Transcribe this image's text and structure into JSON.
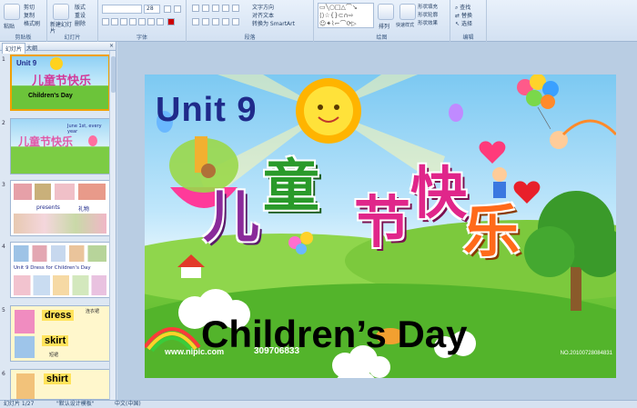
{
  "ribbon": {
    "clipboard": {
      "label": "剪贴板",
      "paste": "粘贴",
      "cut": "剪切",
      "copy": "复制",
      "format_painter": "格式刷"
    },
    "slides": {
      "label": "幻灯片",
      "new_slide": "新建幻灯片",
      "layout": "版式",
      "reset": "重设",
      "delete": "删除"
    },
    "font": {
      "label": "字体",
      "size": "28"
    },
    "paragraph": {
      "label": "段落",
      "text_direction": "文字方向",
      "align_text": "对齐文本",
      "smartart": "转换为 SmartArt"
    },
    "drawing": {
      "label": "绘图",
      "arrange": "排列",
      "quick_styles": "快速样式",
      "shape_fill": "形状填充",
      "shape_outline": "形状轮廓",
      "shape_effects": "形状效果"
    },
    "editing": {
      "label": "编辑",
      "find": "查找",
      "replace": "替换",
      "select": "选择"
    }
  },
  "panel": {
    "tab_slides": "幻灯片",
    "tab_outline": "大纲"
  },
  "slides": [
    {
      "num": "1",
      "title": "Unit 9",
      "subtitle": "Children's Day"
    },
    {
      "num": "2",
      "text": "June 1st, every year"
    },
    {
      "num": "3",
      "left": "presents",
      "right": "礼物"
    },
    {
      "num": "4",
      "text": "Unit 9 Dress for Children's Day"
    },
    {
      "num": "5",
      "word1": "dress",
      "cn1": "连衣裙",
      "word2": "skirt",
      "cn2": "短裙"
    },
    {
      "num": "6",
      "word1": "shirt"
    }
  ],
  "main_slide": {
    "unit": "Unit 9",
    "chinese_title": [
      "儿",
      "童",
      "节",
      "快",
      "乐"
    ],
    "english_title": "Children’s Day",
    "watermark": "www.nipic.com",
    "id_number": "309706833",
    "corner_id": "NO.20100728084831"
  },
  "status": {
    "slide": "幻灯片 1/27",
    "theme": "\"默认设计模板\"",
    "language": "中文(中国)"
  },
  "colors": {
    "ribbon": "#dbe6f4",
    "selected_border": "#f0a000",
    "title_blue": "#1f2a8a"
  }
}
